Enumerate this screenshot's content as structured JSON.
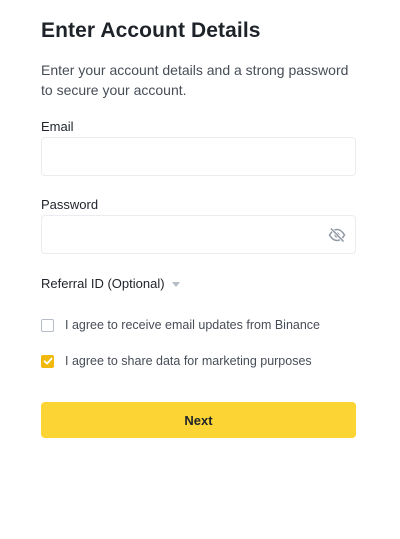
{
  "header": {
    "title": "Enter Account Details",
    "subtitle": "Enter your account details and a strong password to secure your account."
  },
  "form": {
    "email": {
      "label": "Email",
      "value": "",
      "placeholder": ""
    },
    "password": {
      "label": "Password",
      "value": "",
      "placeholder": "",
      "toggle_icon": "eye-slash-icon"
    },
    "referral": {
      "label": "Referral ID (Optional)",
      "icon": "caret-down-icon"
    },
    "checkboxes": [
      {
        "label": "I agree to receive email updates from Binance",
        "checked": false
      },
      {
        "label": "I agree to share data for marketing purposes",
        "checked": true
      }
    ],
    "next_label": "Next"
  },
  "colors": {
    "accent": "#fcd535",
    "check": "#f0b90b",
    "text": "#1e2329",
    "muted": "#474d57",
    "border": "#eaecef"
  }
}
